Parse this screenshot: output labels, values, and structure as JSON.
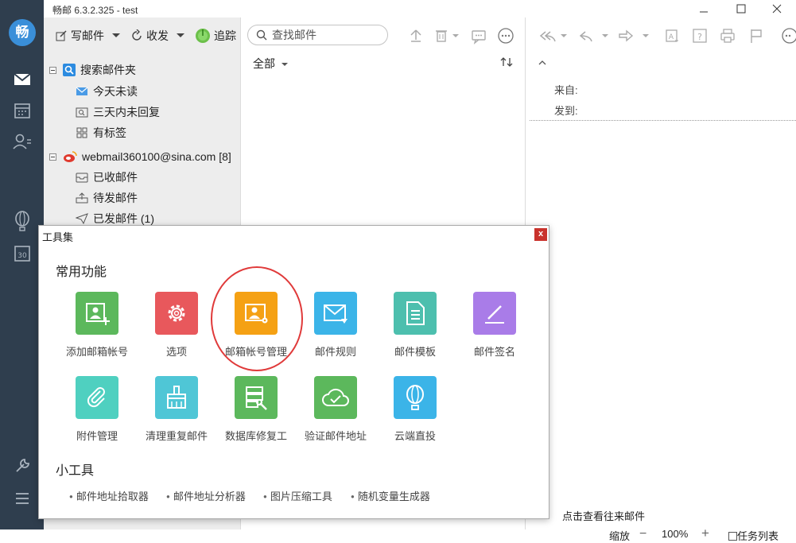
{
  "app": {
    "title": "畅邮 6.3.2.325  -  test",
    "logo_char": "畅"
  },
  "rail": {
    "icons": [
      "mail-icon",
      "calendar-icon",
      "contacts-icon",
      "balloon-icon",
      "calendar-30-icon",
      "wrench-icon",
      "menu-icon"
    ]
  },
  "folder_toolbar": {
    "compose_label": "写邮件",
    "receive_label": "收发",
    "track_label": "追踪"
  },
  "folders": {
    "search_root": "搜索邮件夹",
    "search_items": [
      "今天未读",
      "三天内未回复",
      "有标签"
    ],
    "account": "webmail360100@sina.com [8]",
    "account_items": [
      "已收邮件",
      "待发邮件",
      "已发邮件 (1)"
    ]
  },
  "list": {
    "search_placeholder": "查找邮件",
    "filter_label": "全部"
  },
  "reader": {
    "from_label": "来自:",
    "to_label": "发到:",
    "view_history": "点击查看往来邮件",
    "zoom_label": "缩放",
    "zoom_value": "100%",
    "task_list": "任务列表"
  },
  "dialog": {
    "title": "工具集",
    "close": "x",
    "common_title": "常用功能",
    "tools": [
      {
        "label": "添加邮箱帐号",
        "color": "#5cb85c",
        "icon": "add-account-icon"
      },
      {
        "label": "选项",
        "color": "#e8585c",
        "icon": "gear-icon"
      },
      {
        "label": "邮箱帐号管理",
        "color": "#f5a114",
        "icon": "account-manage-icon"
      },
      {
        "label": "邮件规则",
        "color": "#3bb4e8",
        "icon": "mail-rule-icon"
      },
      {
        "label": "邮件模板",
        "color": "#4dbfae",
        "icon": "template-icon"
      },
      {
        "label": "邮件签名",
        "color": "#a97ce8",
        "icon": "signature-icon"
      },
      {
        "label": "附件管理",
        "color": "#4fd0c0",
        "icon": "paperclip-icon"
      },
      {
        "label": "清理重复邮件",
        "color": "#4fc6d6",
        "icon": "broom-icon"
      },
      {
        "label": "数据库修复工",
        "color": "#5cb85c",
        "icon": "database-repair-icon"
      },
      {
        "label": "验证邮件地址",
        "color": "#5cb85c",
        "icon": "cloud-check-icon"
      },
      {
        "label": "云端直投",
        "color": "#3bb4e8",
        "icon": "balloon-icon"
      }
    ],
    "mini_title": "小工具",
    "mini_tools": [
      "邮件地址拾取器",
      "邮件地址分析器",
      "图片压缩工具",
      "随机变量生成器"
    ]
  }
}
